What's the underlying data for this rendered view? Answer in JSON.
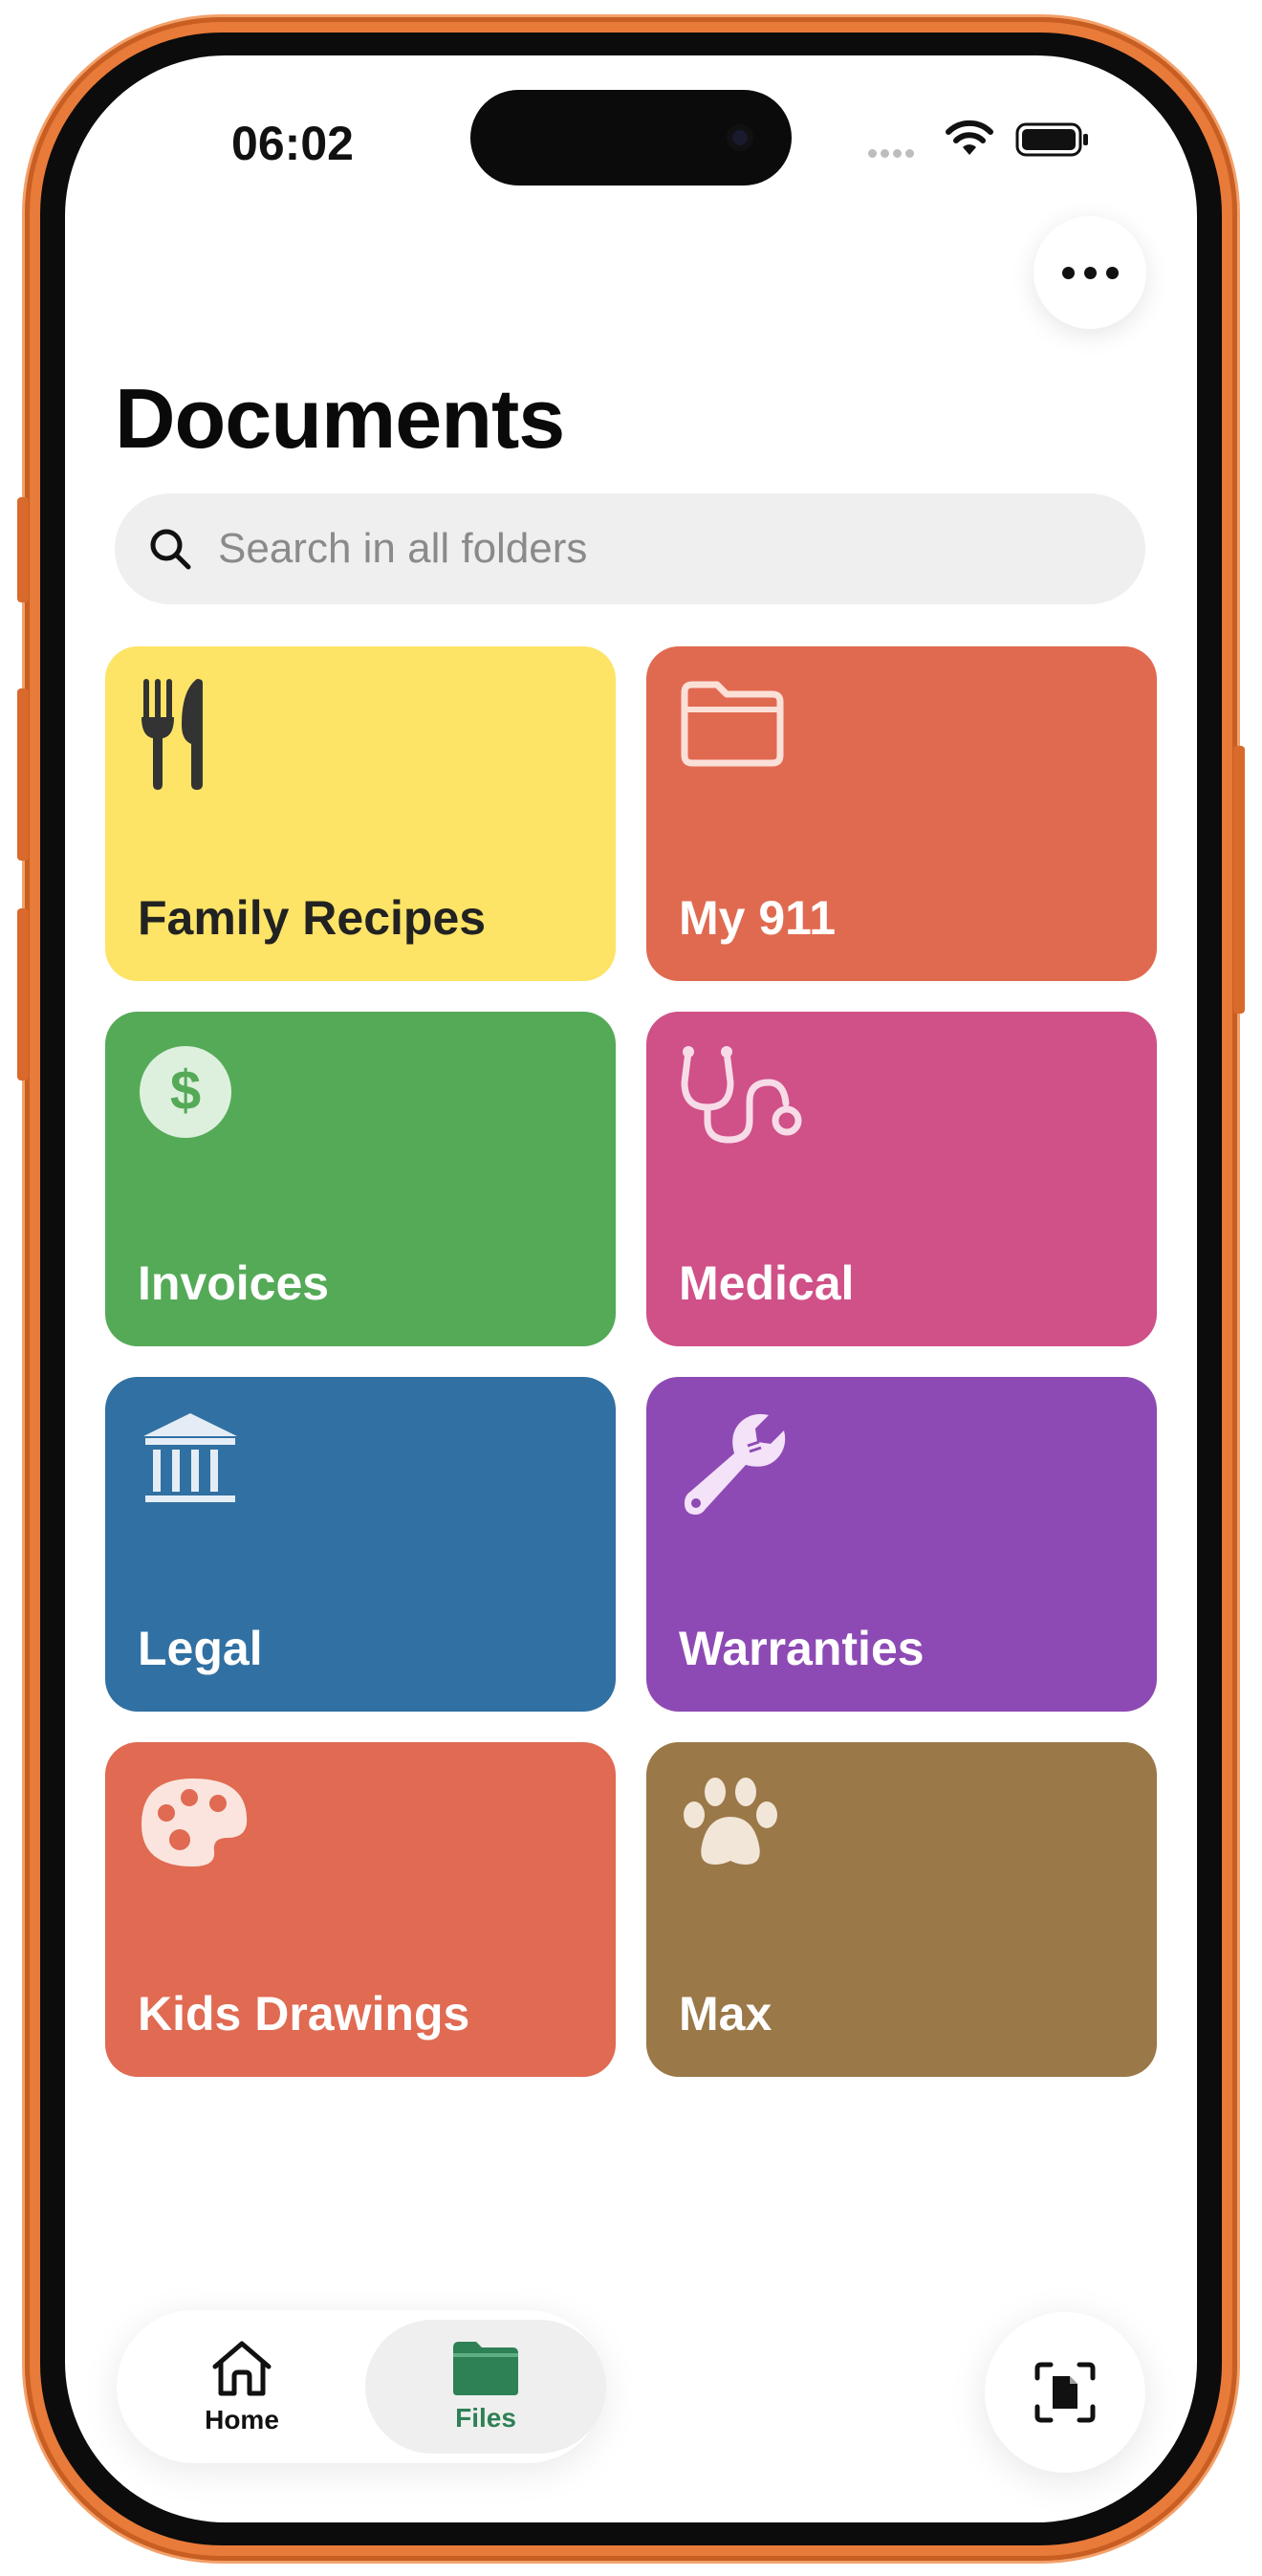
{
  "status_bar": {
    "time": "06:02"
  },
  "header": {
    "title": "Documents",
    "more_icon": "ellipsis-icon"
  },
  "search": {
    "placeholder": "Search in all folders",
    "value": ""
  },
  "folders": [
    {
      "label": "Family Recipes",
      "icon": "fork-knife-icon",
      "color": "#FDE466",
      "text_color": "#222222"
    },
    {
      "label": "My 911",
      "icon": "folder-icon",
      "color": "#E06A50",
      "text_color": "#FFFFFF"
    },
    {
      "label": "Invoices",
      "icon": "dollar-icon",
      "color": "#55AA58",
      "text_color": "#FFFFFF"
    },
    {
      "label": "Medical",
      "icon": "stethoscope-icon",
      "color": "#D05088",
      "text_color": "#FFFFFF"
    },
    {
      "label": "Legal",
      "icon": "bank-icon",
      "color": "#3170A2",
      "text_color": "#FFFFFF"
    },
    {
      "label": "Warranties",
      "icon": "wrench-icon",
      "color": "#8E4AB4",
      "text_color": "#FFFFFF"
    },
    {
      "label": "Kids Drawings",
      "icon": "palette-icon",
      "color": "#E06A52",
      "text_color": "#FFFFFF"
    },
    {
      "label": "Max",
      "icon": "paw-icon",
      "color": "#9B7848",
      "text_color": "#FFFFFF"
    }
  ],
  "nav": {
    "home_label": "Home",
    "files_label": "Files",
    "active": "Files",
    "active_color": "#2E8055"
  },
  "scan_icon": "document-scan-icon"
}
